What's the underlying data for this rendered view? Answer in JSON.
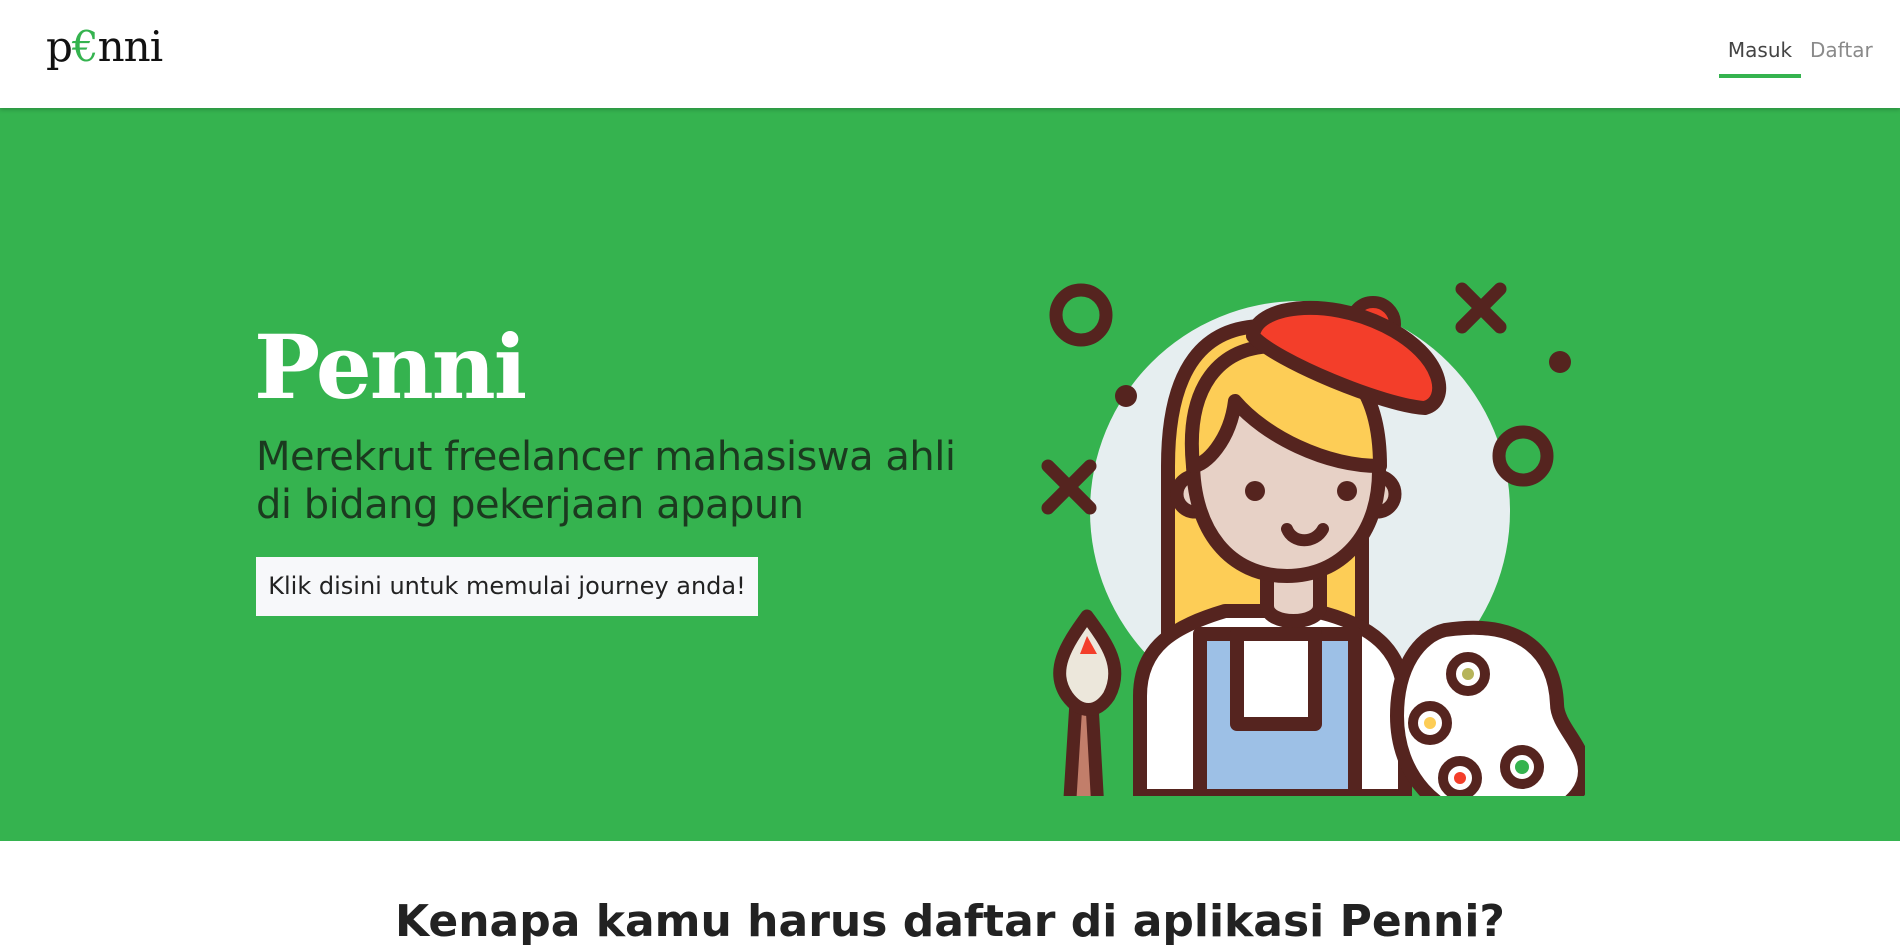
{
  "nav": {
    "brand_prefix": "p",
    "brand_accent": "€",
    "brand_suffix": "nni",
    "links": [
      "Masuk",
      "Daftar"
    ]
  },
  "hero": {
    "title": "Penni",
    "subtitle": "Merekrut freelancer mahasiswa ahli di bidang pekerjaan apapun",
    "cta_label": "Klik disini untuk memulai journey anda!",
    "illustration_icon": "artist-painter-icon"
  },
  "why": {
    "title": "Kenapa kamu harus daftar di aplikasi Penni?"
  },
  "colors": {
    "brand_green": "#35b34f",
    "dark_outline": "#55241f",
    "white": "#ffffff"
  }
}
